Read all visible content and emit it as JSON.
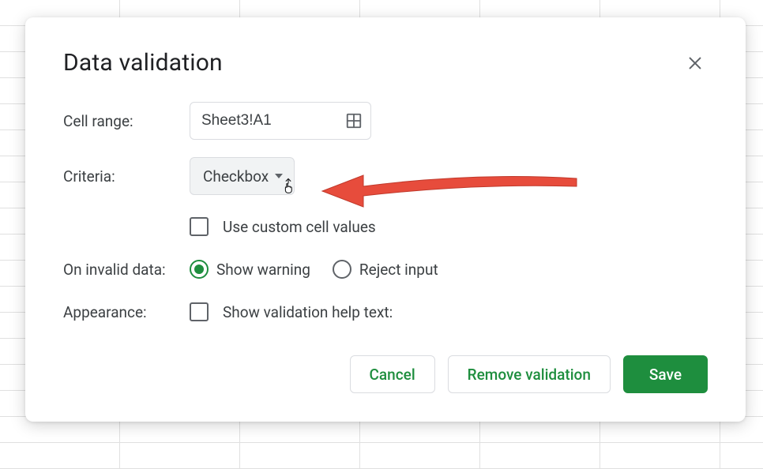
{
  "dialog": {
    "title": "Data validation",
    "labels": {
      "cell_range": "Cell range:",
      "criteria": "Criteria:",
      "on_invalid": "On invalid data:",
      "appearance": "Appearance:"
    },
    "cell_range_value": "Sheet3!A1",
    "criteria_value": "Checkbox",
    "use_custom_values_label": "Use custom cell values",
    "radio": {
      "show_warning": "Show warning",
      "reject_input": "Reject input",
      "selected": "show_warning"
    },
    "help_text_label": "Show validation help text:",
    "buttons": {
      "cancel": "Cancel",
      "remove": "Remove validation",
      "save": "Save"
    }
  },
  "annotation": {
    "arrow_color": "#e94335"
  }
}
